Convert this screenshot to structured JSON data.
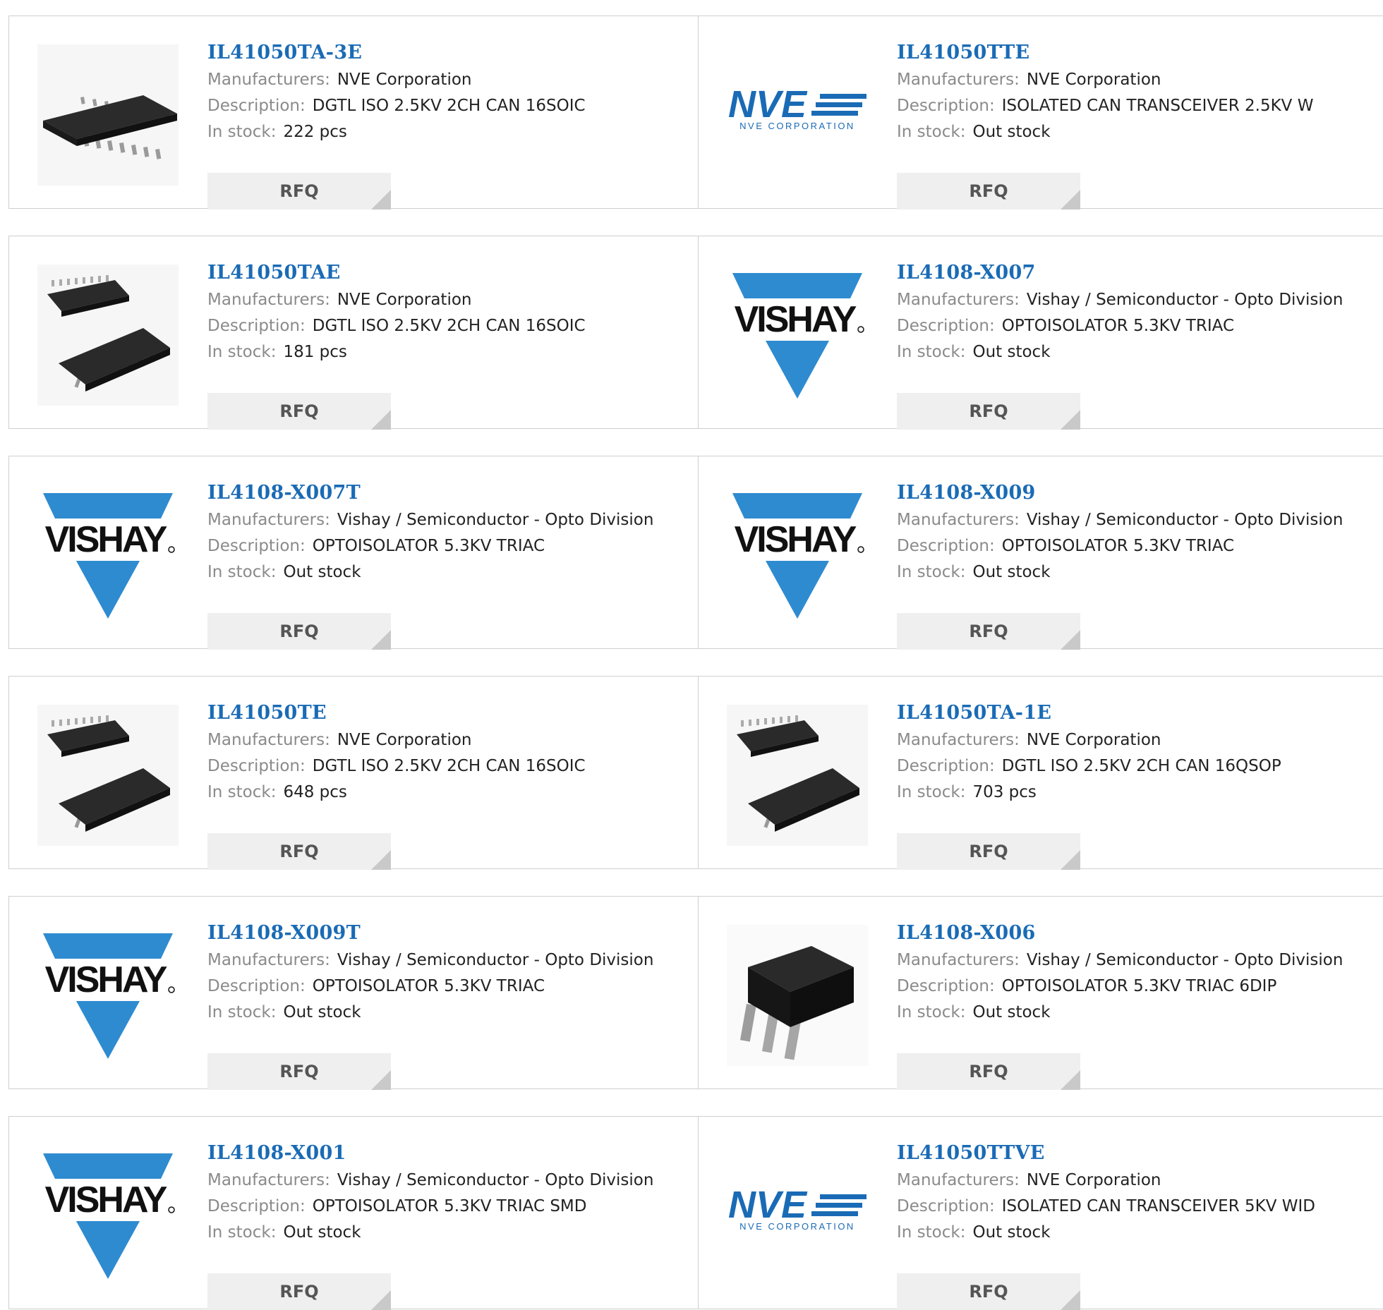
{
  "labels": {
    "manufacturers": "Manufacturers:",
    "description": "Description:",
    "in_stock": "In stock:",
    "rfq": "RFQ"
  },
  "colors": {
    "link": "#1a6bb5",
    "vishay_blue": "#2e8bd0",
    "nve_blue": "#1a6bb5"
  },
  "products": [
    {
      "part": "IL41050TA-3E",
      "manufacturer": "NVE Corporation",
      "description": "DGTL ISO 2.5KV 2CH CAN 16SOIC",
      "stock": "222 pcs",
      "image": "soic-single"
    },
    {
      "part": "IL41050TTE",
      "manufacturer": "NVE Corporation",
      "description": "ISOLATED CAN TRANSCEIVER 2.5KV W",
      "stock": "Out stock",
      "image": "nve-logo"
    },
    {
      "part": "IL41050TAE",
      "manufacturer": "NVE Corporation",
      "description": "DGTL ISO 2.5KV 2CH CAN 16SOIC",
      "stock": "181 pcs",
      "image": "soic-pair"
    },
    {
      "part": "IL4108-X007",
      "manufacturer": "Vishay / Semiconductor - Opto Division",
      "description": "OPTOISOLATOR 5.3KV TRIAC",
      "stock": "Out stock",
      "image": "vishay-logo"
    },
    {
      "part": "IL4108-X007T",
      "manufacturer": "Vishay / Semiconductor - Opto Division",
      "description": "OPTOISOLATOR 5.3KV TRIAC",
      "stock": "Out stock",
      "image": "vishay-logo"
    },
    {
      "part": "IL4108-X009",
      "manufacturer": "Vishay / Semiconductor - Opto Division",
      "description": "OPTOISOLATOR 5.3KV TRIAC",
      "stock": "Out stock",
      "image": "vishay-logo"
    },
    {
      "part": "IL41050TE",
      "manufacturer": "NVE Corporation",
      "description": "DGTL ISO 2.5KV 2CH CAN 16SOIC",
      "stock": "648 pcs",
      "image": "soic-pair"
    },
    {
      "part": "IL41050TA-1E",
      "manufacturer": "NVE Corporation",
      "description": "DGTL ISO 2.5KV 2CH CAN 16QSOP",
      "stock": "703 pcs",
      "image": "soic-pair"
    },
    {
      "part": "IL4108-X009T",
      "manufacturer": "Vishay / Semiconductor - Opto Division",
      "description": "OPTOISOLATOR 5.3KV TRIAC",
      "stock": "Out stock",
      "image": "vishay-logo"
    },
    {
      "part": "IL4108-X006",
      "manufacturer": "Vishay / Semiconductor - Opto Division",
      "description": "OPTOISOLATOR 5.3KV TRIAC 6DIP",
      "stock": "Out stock",
      "image": "dip-chip"
    },
    {
      "part": "IL4108-X001",
      "manufacturer": "Vishay / Semiconductor - Opto Division",
      "description": "OPTOISOLATOR 5.3KV TRIAC SMD",
      "stock": "Out stock",
      "image": "vishay-logo"
    },
    {
      "part": "IL41050TTVE",
      "manufacturer": "NVE Corporation",
      "description": "ISOLATED CAN TRANSCEIVER 5KV WID",
      "stock": "Out stock",
      "image": "nve-logo"
    }
  ],
  "logos": {
    "vishay_text": "VISHAY",
    "nve_text": "NVE",
    "nve_subtext": "NVE CORPORATION"
  }
}
